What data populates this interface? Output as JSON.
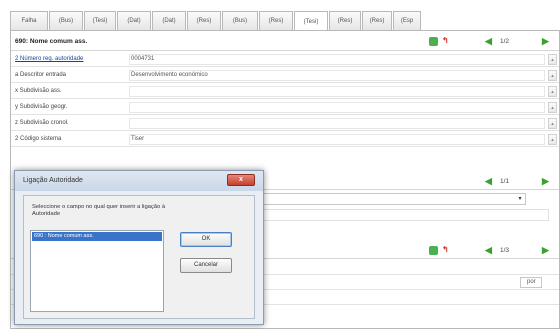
{
  "tabs": [
    "Falha",
    "(Bus)",
    "(Tesi)",
    "(Dat)",
    "(Dat)",
    "(Res)",
    "(Bus)",
    "(Res)",
    "(Tesi)",
    "(Res)",
    "(Res)",
    "(Esp"
  ],
  "active_tab_index": 8,
  "record": {
    "title": "690: Nome comum ass.",
    "pager": "1/2"
  },
  "fields": [
    {
      "label": "2 Número reg. autoridade",
      "value": "0004731",
      "link": true
    },
    {
      "label": "a Descritor entrada",
      "value": "Desenvolvimento económico",
      "link": false
    },
    {
      "label": "x Subdivisão ass.",
      "value": "",
      "link": false
    },
    {
      "label": "y Subdivisão geogr.",
      "value": "",
      "link": false
    },
    {
      "label": "z Subdivisão cronol.",
      "value": "",
      "link": false
    },
    {
      "label": "2 Código sistema",
      "value": "Tiser",
      "link": false
    }
  ],
  "section2": {
    "pager": "1/1"
  },
  "section3": {
    "pager": "1/3"
  },
  "bottom_select": "por",
  "dialog": {
    "title": "Ligação Autoridade",
    "close_label": "x",
    "prompt": "Seleccione o campo no qual quer inserir a ligação à Autoridade",
    "list_items": [
      "690 : Nome comum ass."
    ],
    "ok_label": "OK",
    "cancel_label": "Cancelar"
  },
  "colors": {
    "arrow": "#39a12d",
    "selection": "#3a74c9",
    "close": "#c4402e"
  }
}
